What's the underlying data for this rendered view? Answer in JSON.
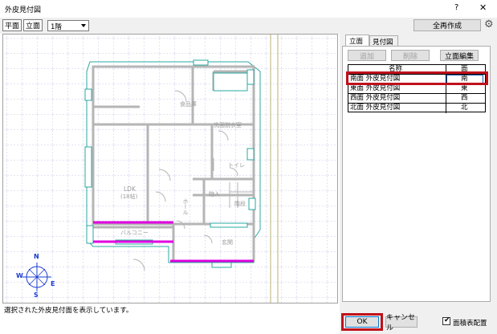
{
  "window": {
    "title": "外皮見付図",
    "help_glyph": "?",
    "close_glyph": "✕"
  },
  "toolbar": {
    "plan_button": "平面",
    "elevation_button": "立面",
    "floor_select": "1階",
    "regenerate_all_button": "全再作成"
  },
  "plan": {
    "room_labels": {
      "dining": "食品庫",
      "washroom": "洗面脱衣室",
      "toilet": "トイレ",
      "ldk": "LDK",
      "ldk_sub": "(18帖)",
      "hall": "ホール",
      "storage": "物入",
      "stairs": "階段",
      "balcony": "バルコニー",
      "entrance": "玄関"
    }
  },
  "compass": {
    "n": "N",
    "s": "S",
    "e": "E",
    "w": "W",
    "color": "#1a3ccf"
  },
  "status_text": "選択された外皮見付面を表示しています。",
  "right_panel": {
    "tabs": [
      "立面",
      "見付図"
    ],
    "add_button": "追加",
    "delete_button": "削除",
    "edit_elevation_button": "立面編集",
    "table": {
      "headers": [
        "名称",
        "面"
      ],
      "rows": [
        [
          "南面 外皮見付図",
          "南"
        ],
        [
          "東面 外皮見付図",
          "東"
        ],
        [
          "西面 外皮見付図",
          "西"
        ],
        [
          "北面 外皮見付図",
          "北"
        ]
      ],
      "selected_index": 0
    }
  },
  "bottom": {
    "ok_button": "OK",
    "cancel_button": "キャンセル",
    "area_table_label": "面積表配置",
    "area_table_checked": true
  },
  "colors": {
    "highlight": "#c0111b",
    "accent_wall": "#e000e0",
    "outline": "#2aa8a0",
    "grid": "#b9b9e3"
  }
}
